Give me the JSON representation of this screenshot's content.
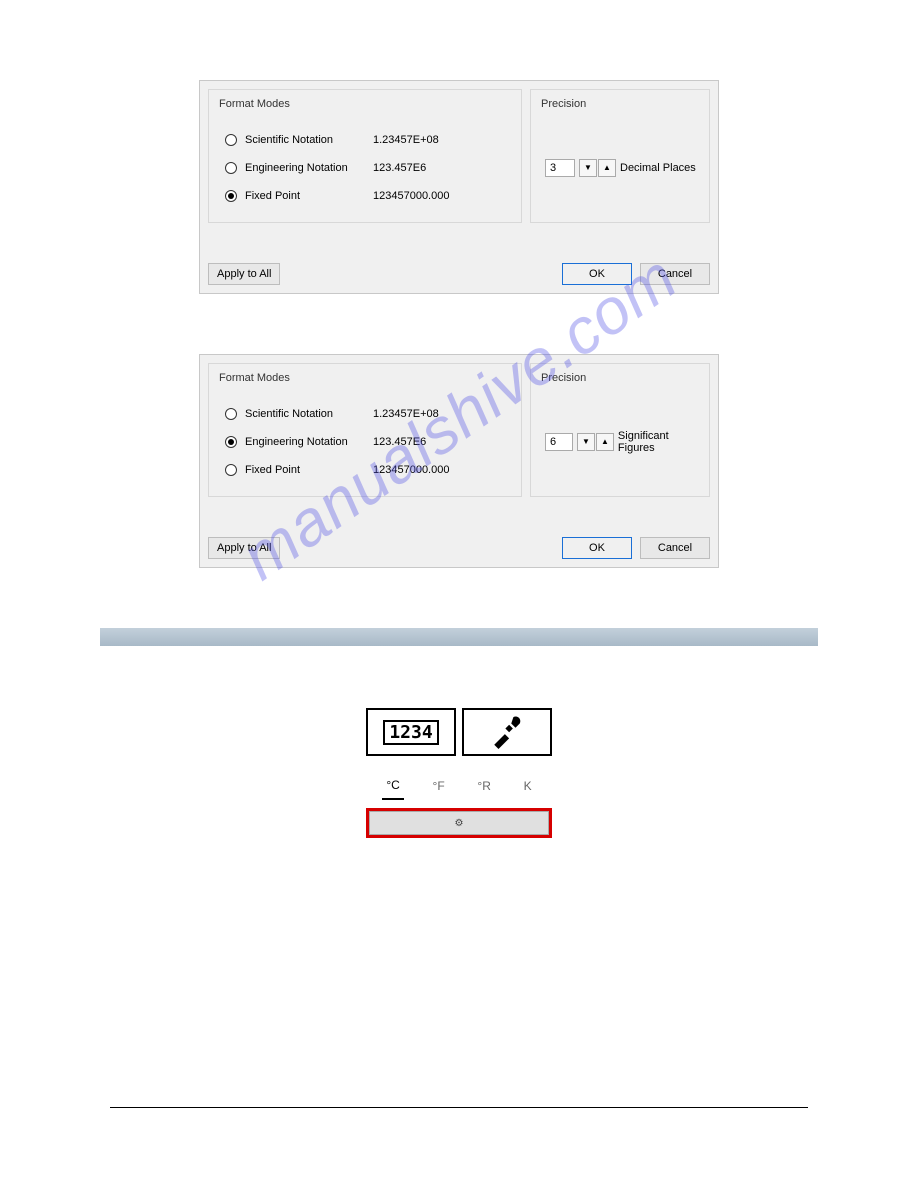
{
  "watermark_text": "manualshive.com",
  "dialog1": {
    "format_modes": {
      "title": "Format Modes",
      "options": [
        {
          "label": "Scientific Notation",
          "example": "1.23457E+08",
          "checked": false
        },
        {
          "label": "Engineering Notation",
          "example": "123.457E6",
          "checked": false
        },
        {
          "label": "Fixed Point",
          "example": "123457000.000",
          "checked": true
        }
      ]
    },
    "precision": {
      "title": "Precision",
      "value": "3",
      "label": "Decimal Places"
    },
    "buttons": {
      "apply_all": "Apply to All",
      "ok": "OK",
      "cancel": "Cancel"
    }
  },
  "dialog2": {
    "format_modes": {
      "title": "Format Modes",
      "options": [
        {
          "label": "Scientific Notation",
          "example": "1.23457E+08",
          "checked": false
        },
        {
          "label": "Engineering Notation",
          "example": "123.457E6",
          "checked": true
        },
        {
          "label": "Fixed Point",
          "example": "123457000.000",
          "checked": false
        }
      ]
    },
    "precision": {
      "title": "Precision",
      "value": "6",
      "label": "Significant Figures"
    },
    "buttons": {
      "apply_all": "Apply to All",
      "ok": "OK",
      "cancel": "Cancel"
    }
  },
  "tool_widget": {
    "num_badge": "1234",
    "units": [
      "°C",
      "°F",
      "°R",
      "K"
    ],
    "active_unit_index": 0
  }
}
